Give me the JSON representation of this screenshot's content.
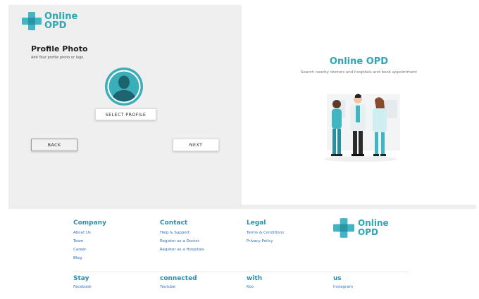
{
  "brand": {
    "line1": "Online",
    "line2": "OPD"
  },
  "profile": {
    "title": "Profile Photo",
    "subtitle": "Add Your profile photo or logo",
    "select_label": "SELECT PROFILE",
    "back_label": "BACK",
    "next_label": "NEXT"
  },
  "hero": {
    "title": "Online OPD",
    "subtitle": "Search nearby doctors and hospitals and book appointment"
  },
  "footer": {
    "company": {
      "heading": "Company",
      "links": [
        "About Us",
        "Team",
        "Career",
        "Blog"
      ]
    },
    "contact": {
      "heading": "Contact",
      "links": [
        "Help & Support",
        "Register as a Doctor",
        "Register as a Hospitals"
      ]
    },
    "legal": {
      "heading": "Legal",
      "links": [
        "Terms & Conditions",
        "Privacy Policy"
      ]
    },
    "stay": [
      {
        "heading": "Stay",
        "link": "Facebook"
      },
      {
        "heading": "connected",
        "link": "Youtube"
      },
      {
        "heading": "with",
        "link": "Koo"
      },
      {
        "heading": "us",
        "link": "Instagram"
      }
    ]
  },
  "colors": {
    "accent": "#2fa6b2",
    "link": "#2a6fc0",
    "panel": "#efefef"
  },
  "icons": [
    "medical-cross-icon",
    "user-avatar-icon"
  ]
}
